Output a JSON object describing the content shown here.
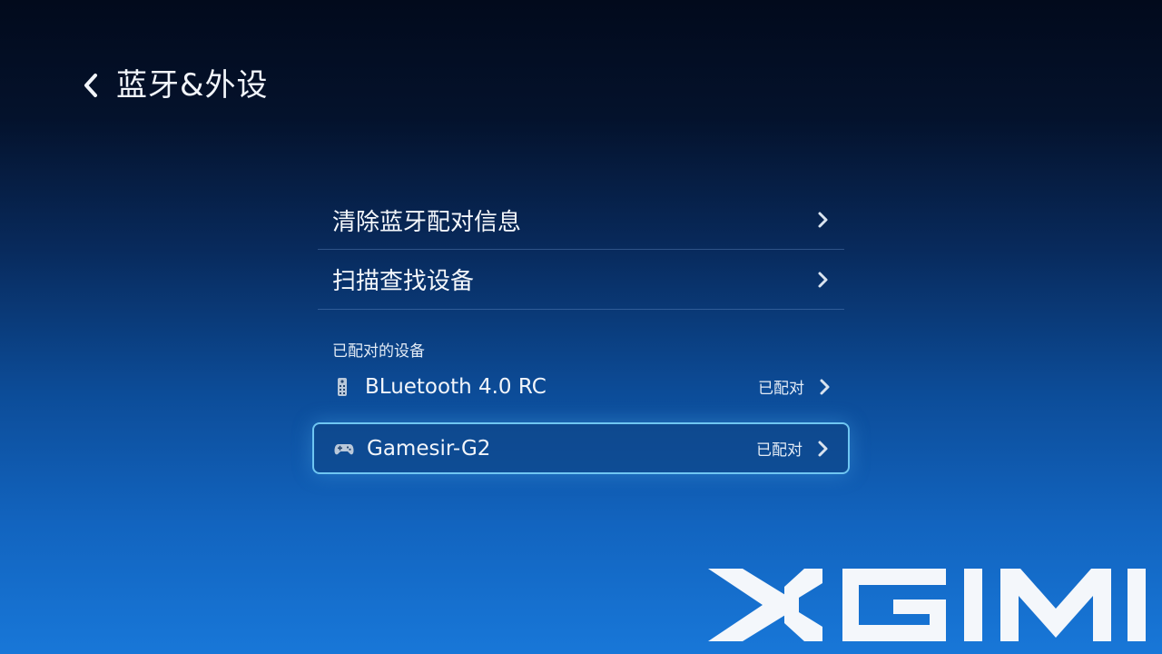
{
  "header": {
    "title": "蓝牙&外设",
    "back_icon": "chevron-left-icon"
  },
  "menu": {
    "items": [
      {
        "label": "清除蓝牙配对信息",
        "icon": "chevron-right-icon"
      },
      {
        "label": "扫描查找设备",
        "icon": "chevron-right-icon"
      }
    ]
  },
  "paired": {
    "title": "已配对的设备",
    "devices": [
      {
        "name": "BLuetooth 4.0 RC",
        "status": "已配对",
        "icon": "remote-control-icon",
        "focused": false
      },
      {
        "name": "Gamesir-G2",
        "status": "已配对",
        "icon": "gamepad-icon",
        "focused": true
      }
    ]
  },
  "brand": {
    "logo_text": "XGIMI"
  },
  "colors": {
    "focus_border": "#6fc6f2",
    "bg_top": "#020a1c",
    "bg_bottom": "#1877d8"
  }
}
